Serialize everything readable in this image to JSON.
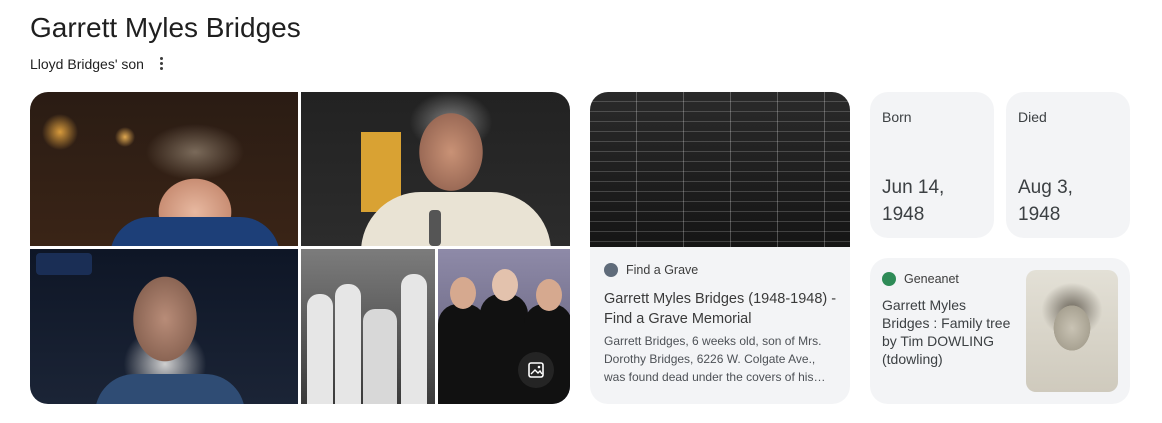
{
  "header": {
    "title": "Garrett Myles Bridges",
    "subtitle": "Lloyd Bridges' son"
  },
  "images": [
    {
      "name": "beau-bridges-photo"
    },
    {
      "name": "jeff-bridges-comic-con-photo"
    },
    {
      "name": "jeff-bridges-portrait-photo"
    },
    {
      "name": "bridges-family-photo"
    },
    {
      "name": "bridges-men-tuxedo-photo"
    }
  ],
  "findagrave": {
    "source": "Find a Grave",
    "title": "Garrett Myles Bridges (1948-1948) - Find a Grave Memorial",
    "snippet": "Garrett Bridges, 6 weeks old, son of Mrs. Dorothy Bridges, 6226 W. Colgate Ave., was found dead under the covers of his…"
  },
  "facts": {
    "born_label": "Born",
    "born_value": "Jun 14, 1948",
    "died_label": "Died",
    "died_value": "Aug 3, 1948"
  },
  "geneanet": {
    "source": "Geneanet",
    "title": "Garrett Myles Bridges : Family tree by Tim DOWLING (tdowling)"
  },
  "colors": {
    "background": "#ffffff",
    "card_background": "#f3f4f6",
    "text_primary": "#1f1f1f",
    "geneanet_icon": "#2e8b57"
  }
}
